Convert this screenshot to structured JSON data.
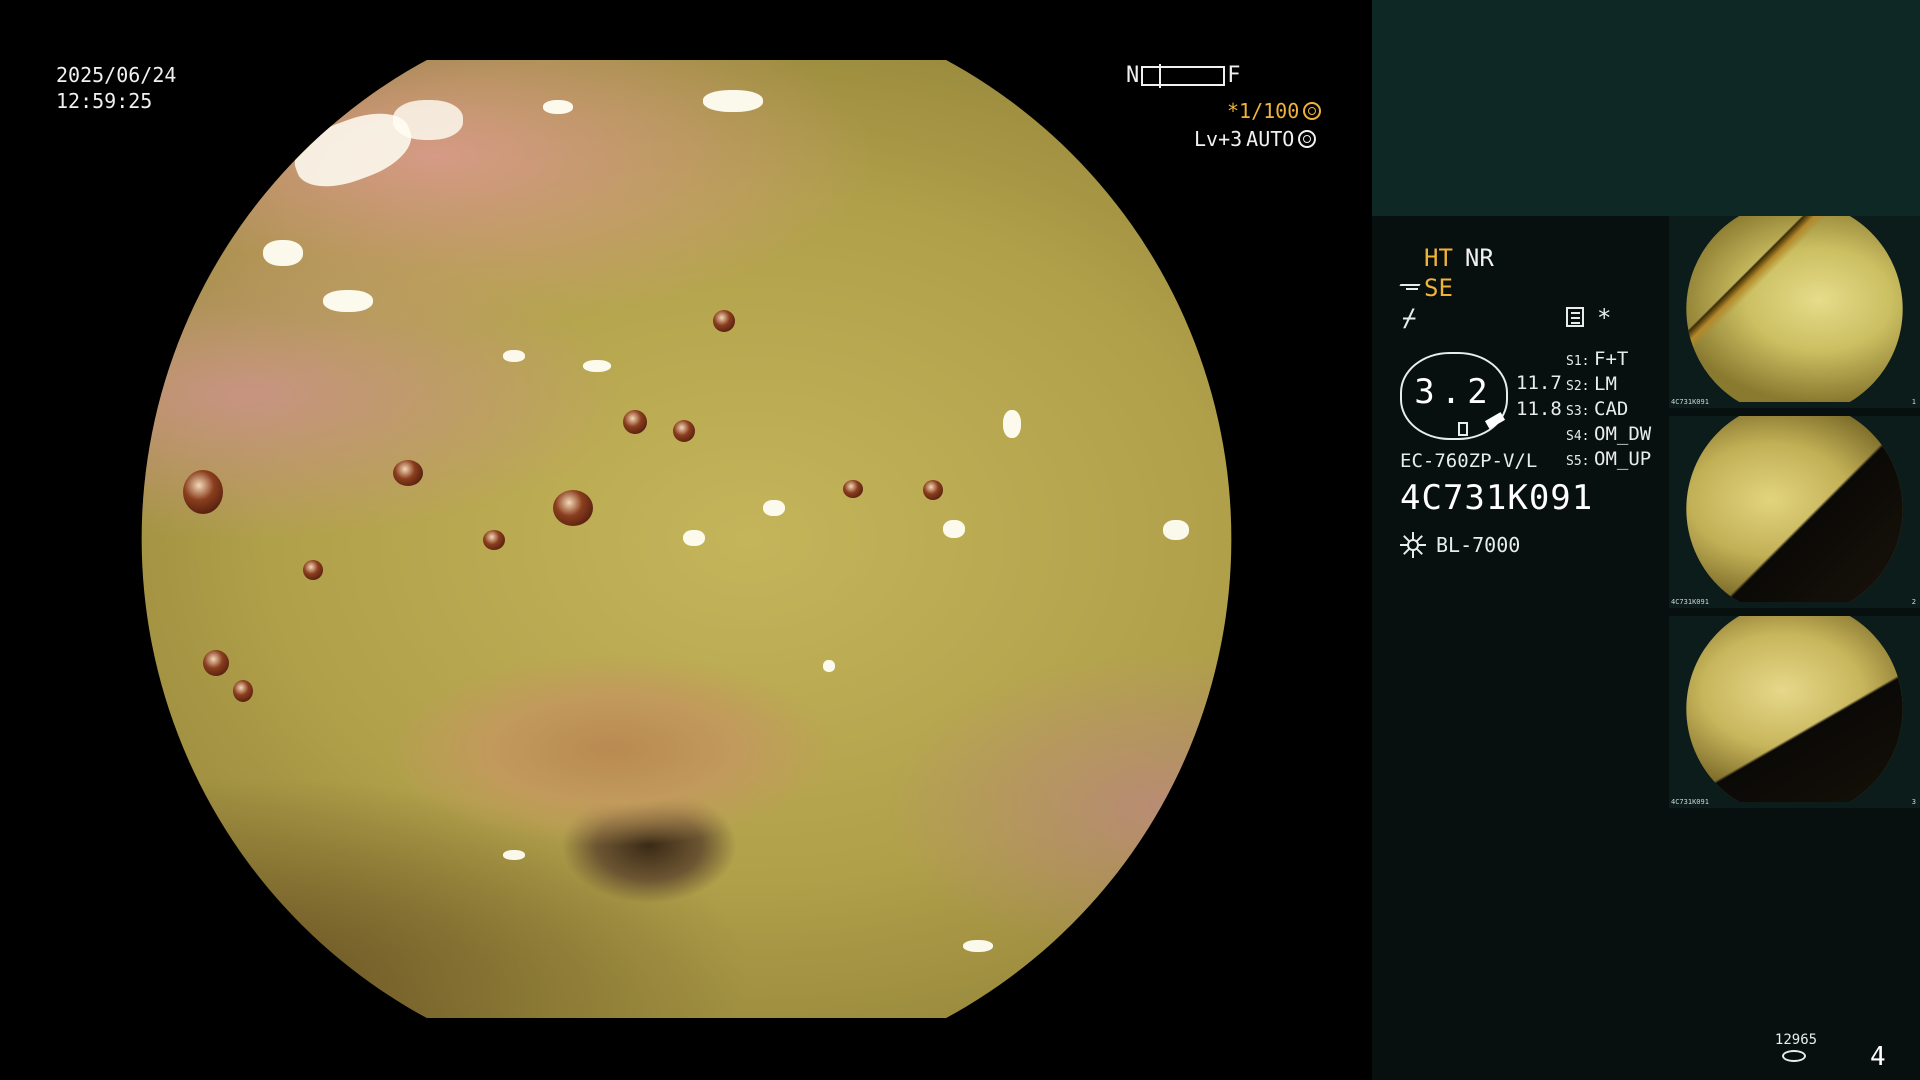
{
  "overlay": {
    "date": "2025/06/24",
    "time": "12:59:25",
    "scale_near": "N",
    "scale_far": "F",
    "shutter": "*1/100",
    "level": "Lv+3",
    "auto": "AUTO"
  },
  "panel": {
    "mode_ht": "HT",
    "mode_nr": "NR",
    "mode_se": "SE",
    "star": "*",
    "zoom_value": "3.2",
    "zoom_r1": "11.7",
    "zoom_r2": "11.8",
    "switches": [
      {
        "key": "S1:",
        "value": "F+T"
      },
      {
        "key": "S2:",
        "value": "LM"
      },
      {
        "key": "S3:",
        "value": "CAD"
      },
      {
        "key": "S4:",
        "value": "OM_DW"
      },
      {
        "key": "S5:",
        "value": "OM_UP"
      }
    ],
    "scope_model": "EC-760ZP-V/L",
    "scope_serial": "4C731K091",
    "light_source": "BL-7000",
    "thumbnails": [
      {
        "caption": "4C731K091",
        "index": "1"
      },
      {
        "caption": "4C731K091",
        "index": "2"
      },
      {
        "caption": "4C731K091",
        "index": "3"
      }
    ],
    "capture_count": "12965",
    "page_number": "4"
  },
  "colors": {
    "accent_orange": "#f0b33a",
    "panel_bg": "#07100f",
    "panel_top": "#0e2826"
  }
}
